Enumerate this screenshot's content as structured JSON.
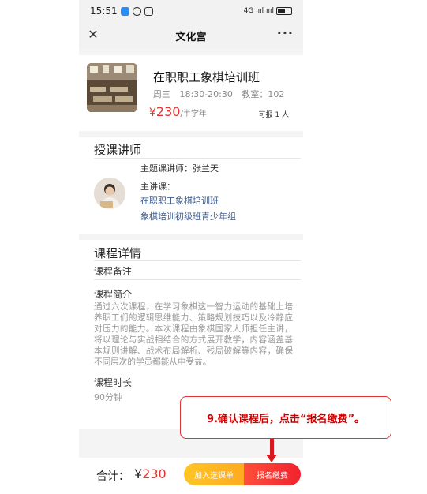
{
  "status_bar": {
    "time": "15:51",
    "signal_text": "4G ıııl ıııl"
  },
  "nav": {
    "close_icon": "close-icon",
    "title": "文化宫",
    "more_icon": "more-icon"
  },
  "course": {
    "name": "在职职工象棋培训班",
    "day": "周三",
    "time": "18:30-20:30",
    "room": "教室：102",
    "price_symbol": "¥",
    "price": "230",
    "price_unit": "/半学年",
    "quota": "可报 1 人"
  },
  "teacher": {
    "section_title": "授课讲师",
    "name_line": "主题课讲师：张兰天",
    "courses_label": "主讲课：",
    "courses": [
      "在职职工象棋培训班",
      "象棋培训初级班青少年组"
    ]
  },
  "detail": {
    "section_title": "课程详情",
    "remark_label": "课程备注",
    "intro_label": "课程简介",
    "intro_text": "通过六次课程，在学习象棋这一智力运动的基础上培养职工们的逻辑思维能力、策略规划技巧以及冷静应对压力的能力。本次课程由象棋国家大师担任主讲，将以理论与实战相结合的方式展开教学，内容涵盖基本规则讲解、战术布局解析、残局破解等内容，确保不同层次的学员都能从中受益。",
    "duration_label": "课程时长",
    "duration_value": "90分钟"
  },
  "bottom": {
    "total_label": "合计：",
    "total_symbol": "¥",
    "total_value": "230",
    "add_cart_label": "加入选课单",
    "pay_label": "报名缴费"
  },
  "annotation": {
    "text": "9.确认课程后，点击“报名缴费”。"
  },
  "colors": {
    "price_red": "#e3342f",
    "link_blue": "#3b5a8c",
    "cart_yellow": "#ffb522",
    "pay_red": "#f0222d",
    "annotation_red": "#d6191f"
  }
}
